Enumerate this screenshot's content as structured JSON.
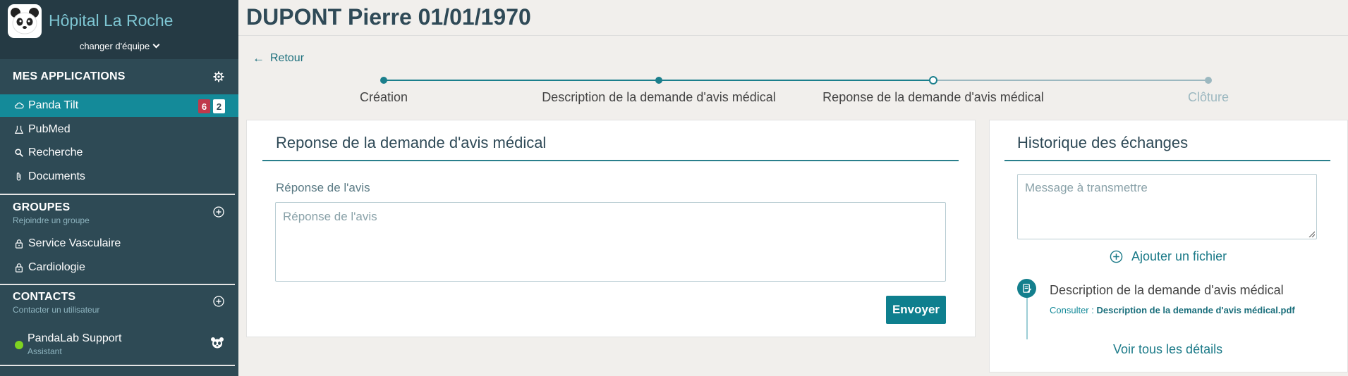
{
  "sidebar": {
    "hospital_name": "Hôpital La Roche",
    "team_switch": "changer d'équipe",
    "apps_header": "MES APPLICATIONS",
    "apps": [
      {
        "label": "Panda Tilt",
        "badge_red": "6",
        "badge_white": "2"
      },
      {
        "label": "PubMed"
      },
      {
        "label": "Recherche"
      },
      {
        "label": "Documents"
      }
    ],
    "groups_header": "GROUPES",
    "groups_sub": "Rejoindre un groupe",
    "groups": [
      {
        "label": "Service Vasculaire"
      },
      {
        "label": "Cardiologie"
      }
    ],
    "contacts_header": "CONTACTS",
    "contacts_sub": "Contacter un utilisateur",
    "contacts": [
      {
        "name": "PandaLab Support",
        "role": "Assistant",
        "status": "online"
      }
    ]
  },
  "main": {
    "title": "DUPONT Pierre 01/01/1970",
    "back_label": "Retour",
    "steps": [
      {
        "label": "Création",
        "state": "done"
      },
      {
        "label": "Description de la demande d'avis médical",
        "state": "done"
      },
      {
        "label": "Reponse de la demande d'avis médical",
        "state": "current"
      },
      {
        "label": "Clôture",
        "state": "pending"
      }
    ],
    "response_panel": {
      "title": "Reponse de la demande d'avis médical",
      "field_label": "Réponse de l'avis",
      "placeholder": "Réponse de l'avis",
      "submit_label": "Envoyer"
    },
    "history_panel": {
      "title": "Historique des échanges",
      "message_placeholder": "Message à transmettre",
      "add_file_label": "Ajouter un fichier",
      "entries": [
        {
          "title": "Description de la demande d'avis médical",
          "consult_prefix": "Consulter :",
          "file_name": "Description de la demande d'avis médical.pdf"
        }
      ],
      "see_all_label": "Voir tous les détails"
    }
  },
  "colors": {
    "sidebar_bg": "#2e4a55",
    "accent": "#148a99",
    "badge_red": "#c0394b",
    "online": "#7ed321"
  }
}
